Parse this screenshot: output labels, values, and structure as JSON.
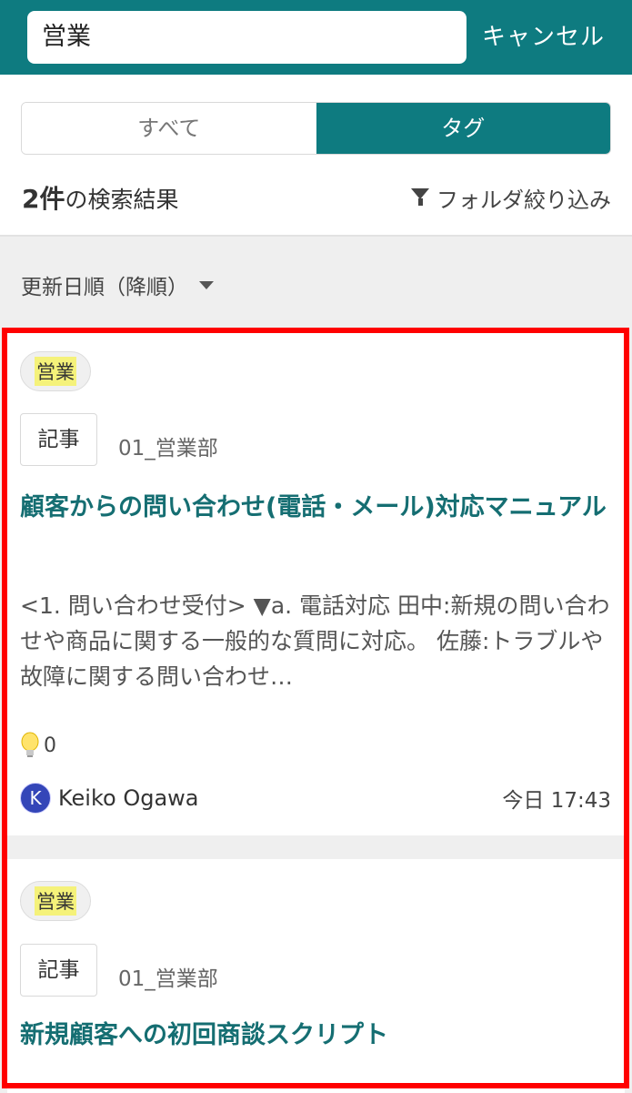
{
  "search": {
    "query": "営業",
    "cancel_label": "キャンセル"
  },
  "segments": {
    "all_label": "すべて",
    "tag_label": "タグ",
    "active": "tag"
  },
  "results": {
    "count": "2件",
    "suffix": "の検索結果",
    "filter_label": "フォルダ絞り込み"
  },
  "sort": {
    "label": "更新日順（降順）"
  },
  "colors": {
    "accent": "#0e7b80",
    "title": "#156e72",
    "highlight": "#f5f27a",
    "frame": "#ff0000"
  },
  "cards": [
    {
      "tag": "営業",
      "type": "記事",
      "folder": "01_営業部",
      "title": "顧客からの問い合わせ(電話・メール)対応マニュアル",
      "excerpt": "<1. 問い合わせ受付> ▼a. 電話対応 田中:新規の問い合わせや商品に関する一般的な質問に対応。 佐藤:トラブルや故障に関する問い合わせ…",
      "likes": "0",
      "author": "Keiko Ogawa",
      "author_initial": "K",
      "date": "今日 17:43"
    },
    {
      "tag": "営業",
      "type": "記事",
      "folder": "01_営業部",
      "title": "新規顧客への初回商談スクリプト"
    }
  ]
}
